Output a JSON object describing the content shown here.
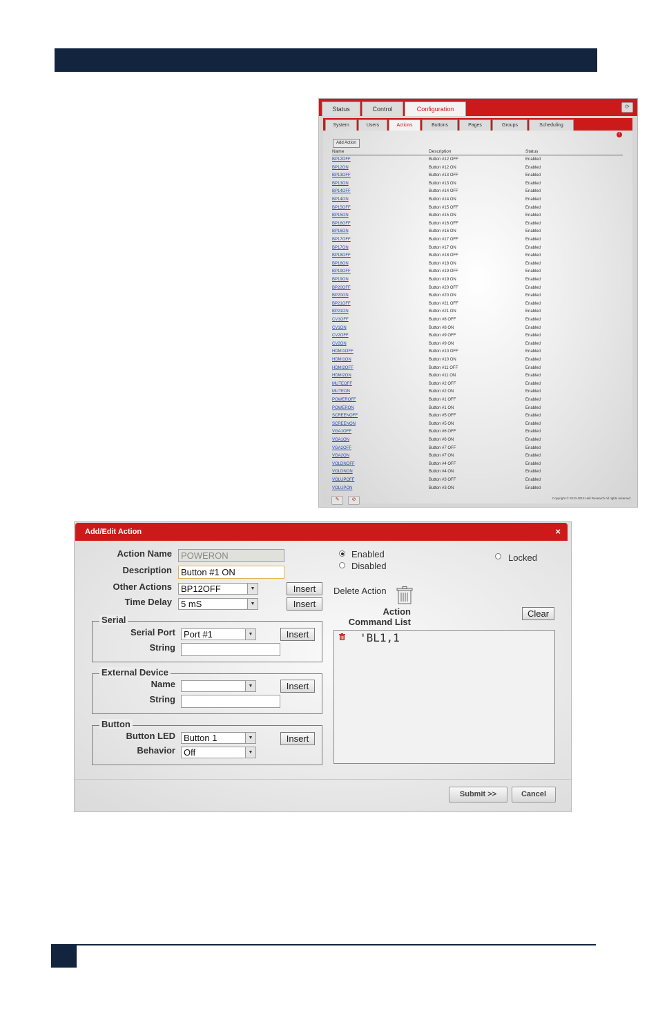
{
  "web_ui": {
    "main_tabs": [
      {
        "label": "Status",
        "active": false
      },
      {
        "label": "Control",
        "active": false
      },
      {
        "label": "Configuration",
        "active": true
      }
    ],
    "sub_tabs": [
      {
        "label": "System",
        "active": false
      },
      {
        "label": "Users",
        "active": false
      },
      {
        "label": "Actions",
        "active": true
      },
      {
        "label": "Buttons",
        "active": false
      },
      {
        "label": "Pages",
        "active": false
      },
      {
        "label": "Groups",
        "active": false
      },
      {
        "label": "Scheduling",
        "active": false
      }
    ],
    "add_action_label": "Add Action",
    "columns": {
      "name": "Name",
      "description": "Description",
      "status": "Status"
    },
    "rows": [
      {
        "name": "BP12OFF",
        "description": "Button #12 OFF",
        "status": "Enabled"
      },
      {
        "name": "BP12ON",
        "description": "Button #12 ON",
        "status": "Enabled"
      },
      {
        "name": "BP13OFF",
        "description": "Button #13 OFF",
        "status": "Enabled"
      },
      {
        "name": "BP13ON",
        "description": "Button #13 ON",
        "status": "Enabled"
      },
      {
        "name": "BP14OFF",
        "description": "Button #14 OFF",
        "status": "Enabled"
      },
      {
        "name": "BP14ON",
        "description": "Button #14 ON",
        "status": "Enabled"
      },
      {
        "name": "BP15OFF",
        "description": "Button #15 OFF",
        "status": "Enabled"
      },
      {
        "name": "BP15ON",
        "description": "Button #15 ON",
        "status": "Enabled"
      },
      {
        "name": "BP16OFF",
        "description": "Button #16 OFF",
        "status": "Enabled"
      },
      {
        "name": "BP16ON",
        "description": "Button #16 ON",
        "status": "Enabled"
      },
      {
        "name": "BP17OFF",
        "description": "Button #17 OFF",
        "status": "Enabled"
      },
      {
        "name": "BP17ON",
        "description": "Button #17 ON",
        "status": "Enabled"
      },
      {
        "name": "BP18OFF",
        "description": "Button #18 OFF",
        "status": "Enabled"
      },
      {
        "name": "BP18ON",
        "description": "Button #18 ON",
        "status": "Enabled"
      },
      {
        "name": "BP19OFF",
        "description": "Button #19 OFF",
        "status": "Enabled"
      },
      {
        "name": "BP19ON",
        "description": "Button #19 ON",
        "status": "Enabled"
      },
      {
        "name": "BP20OFF",
        "description": "Button #20 OFF",
        "status": "Enabled"
      },
      {
        "name": "BP20ON",
        "description": "Button #20 ON",
        "status": "Enabled"
      },
      {
        "name": "BP21OFF",
        "description": "Button #21 OFF",
        "status": "Enabled"
      },
      {
        "name": "BP21ON",
        "description": "Button #21 ON",
        "status": "Enabled"
      },
      {
        "name": "CV1OFF",
        "description": "Button #8 OFF",
        "status": "Enabled"
      },
      {
        "name": "CV1ON",
        "description": "Button #8 ON",
        "status": "Enabled"
      },
      {
        "name": "CV2OFF",
        "description": "Button #9 OFF",
        "status": "Enabled"
      },
      {
        "name": "CV2ON",
        "description": "Button #9 ON",
        "status": "Enabled"
      },
      {
        "name": "HDMI1OFF",
        "description": "Button #10 OFF",
        "status": "Enabled"
      },
      {
        "name": "HDMI1ON",
        "description": "Button #10 ON",
        "status": "Enabled"
      },
      {
        "name": "HDMI2OFF",
        "description": "Button #11 OFF",
        "status": "Enabled"
      },
      {
        "name": "HDMI2ON",
        "description": "Button #11 ON",
        "status": "Enabled"
      },
      {
        "name": "MUTEOFF",
        "description": "Button #2 OFF",
        "status": "Enabled"
      },
      {
        "name": "MUTEON",
        "description": "Button #2 ON",
        "status": "Enabled"
      },
      {
        "name": "POWEROFF",
        "description": "Button #1 OFF",
        "status": "Enabled"
      },
      {
        "name": "POWERON",
        "description": "Button #1 ON",
        "status": "Enabled"
      },
      {
        "name": "SCREENOFF",
        "description": "Button #5 OFF",
        "status": "Enabled"
      },
      {
        "name": "SCREENON",
        "description": "Button #5 ON",
        "status": "Enabled"
      },
      {
        "name": "VGA1OFF",
        "description": "Button #6 OFF",
        "status": "Enabled"
      },
      {
        "name": "VGA1ON",
        "description": "Button #6 ON",
        "status": "Enabled"
      },
      {
        "name": "VGA2OFF",
        "description": "Button #7 OFF",
        "status": "Enabled"
      },
      {
        "name": "VGA2ON",
        "description": "Button #7 ON",
        "status": "Enabled"
      },
      {
        "name": "VOLDNOFF",
        "description": "Button #4 OFF",
        "status": "Enabled"
      },
      {
        "name": "VOLDNON",
        "description": "Button #4 ON",
        "status": "Enabled"
      },
      {
        "name": "VOLUPOFF",
        "description": "Button #3 OFF",
        "status": "Enabled"
      },
      {
        "name": "VOLUPON",
        "description": "Button #3 ON",
        "status": "Enabled"
      }
    ],
    "copyright": "Copyright © 2010-2013 Hall Research All rights reserved"
  },
  "dialog": {
    "title": "Add/Edit Action",
    "close_glyph": "×",
    "action_name_label": "Action Name",
    "action_name_value": "POWERON",
    "description_label": "Description",
    "description_value": "Button #1 ON",
    "other_actions_label": "Other Actions",
    "other_actions_value": "BP12OFF",
    "time_delay_label": "Time Delay",
    "time_delay_value": "5 mS",
    "insert_label": "Insert",
    "enabled_label": "Enabled",
    "disabled_label": "Disabled",
    "locked_label": "Locked",
    "enabled_selected": true,
    "delete_action_label": "Delete Action",
    "command_list_label_line1": "Action",
    "command_list_label_line2": "Command List",
    "clear_label": "Clear",
    "commands": [
      "'BL1,1"
    ],
    "serial": {
      "legend": "Serial",
      "port_label": "Serial Port",
      "port_value": "Port #1",
      "string_label": "String",
      "string_value": ""
    },
    "external": {
      "legend": "External Device",
      "name_label": "Name",
      "name_value": "",
      "string_label": "String",
      "string_value": ""
    },
    "button": {
      "legend": "Button",
      "led_label": "Button LED",
      "led_value": "Button 1",
      "behavior_label": "Behavior",
      "behavior_value": "Off"
    },
    "submit_label": "Submit >>",
    "cancel_label": "Cancel"
  },
  "colors": {
    "header_navy": "#13243f",
    "accent_red": "#cc1a1a",
    "link_blue": "#2a4aa8"
  }
}
